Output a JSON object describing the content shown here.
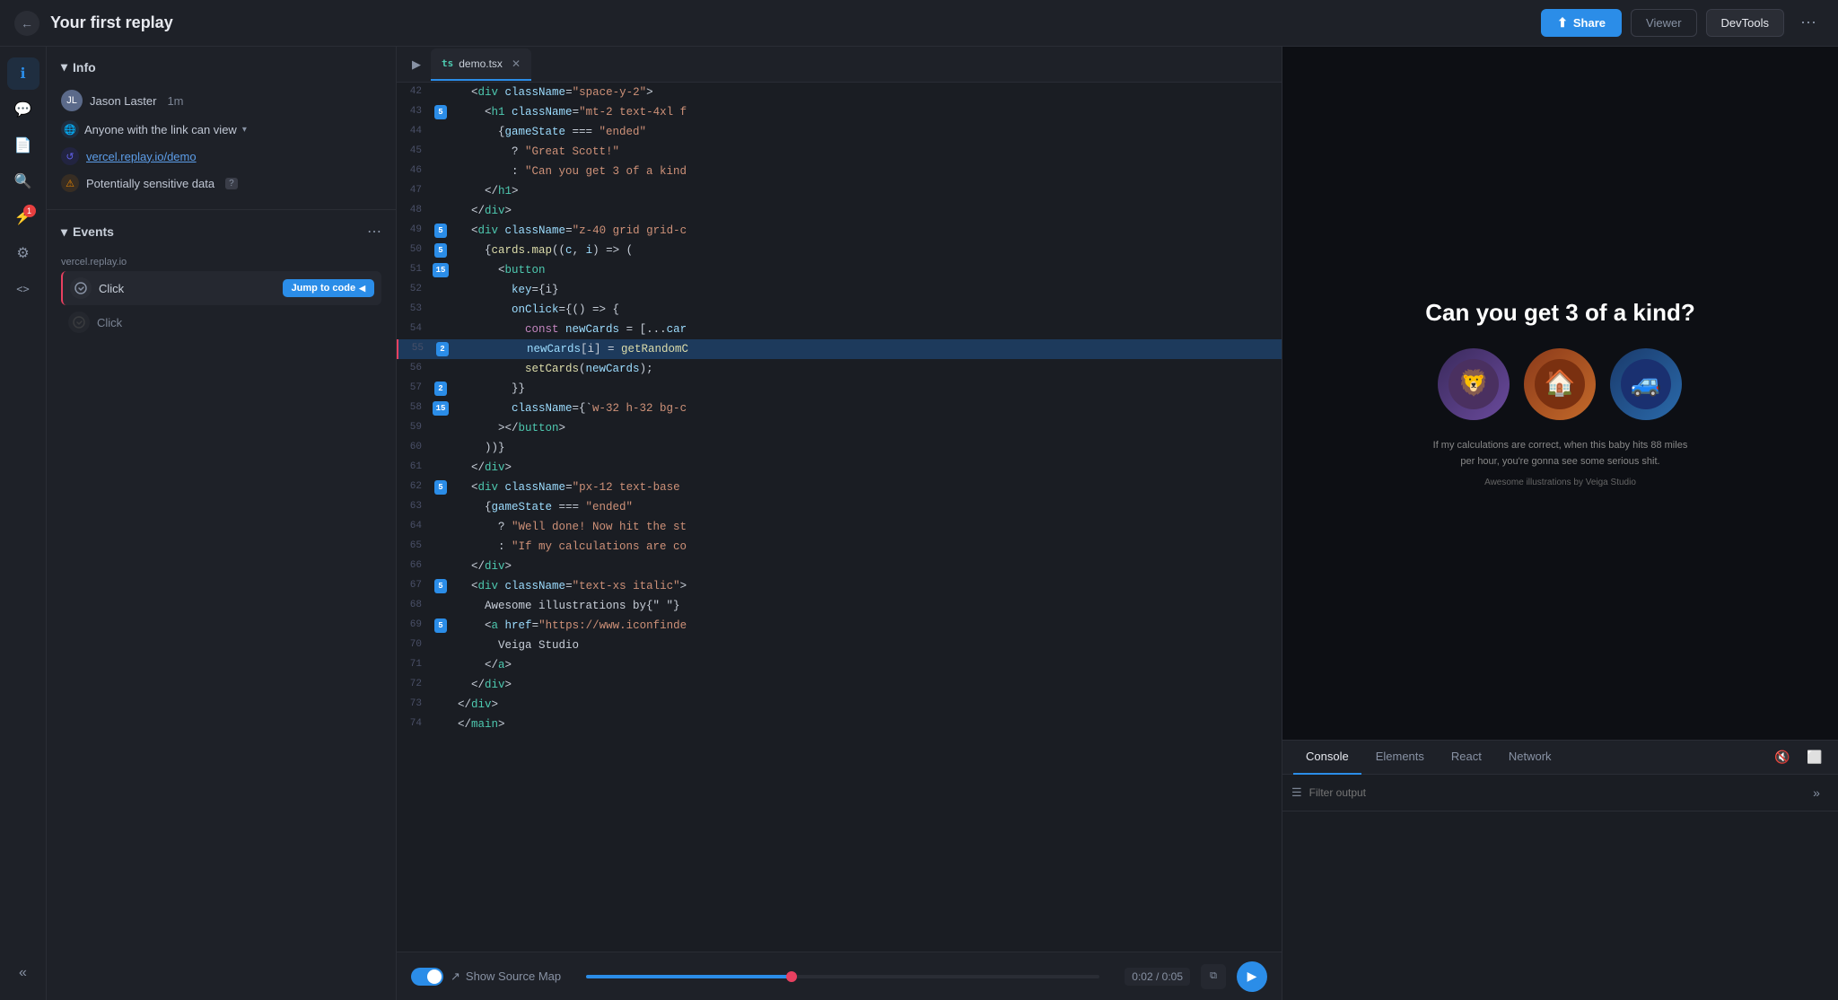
{
  "topbar": {
    "back_icon": "←",
    "title": "Your first replay",
    "share_label": "Share",
    "viewer_label": "Viewer",
    "devtools_label": "DevTools",
    "more_icon": "⋯"
  },
  "sidebar": {
    "icons": [
      {
        "name": "info-icon",
        "symbol": "ℹ",
        "active": true
      },
      {
        "name": "comment-icon",
        "symbol": "💬",
        "active": false
      },
      {
        "name": "document-icon",
        "symbol": "📄",
        "active": false
      },
      {
        "name": "search-icon",
        "symbol": "🔍",
        "active": false
      },
      {
        "name": "activity-icon",
        "symbol": "⚡",
        "active": false,
        "badge": "1"
      },
      {
        "name": "settings-icon",
        "symbol": "⚙",
        "active": false
      },
      {
        "name": "code-icon",
        "symbol": "<>",
        "active": false
      },
      {
        "name": "collapse-icon",
        "symbol": "«",
        "active": false
      }
    ]
  },
  "info": {
    "section_label": "Info",
    "user_name": "Jason Laster",
    "user_timestamp": "1m",
    "link_text": "Anyone with the link can view",
    "url": "vercel.replay.io/demo",
    "sensitive_label": "Potentially sensitive data",
    "help_label": "?"
  },
  "events": {
    "section_label": "Events",
    "group_label": "vercel.replay.io",
    "items": [
      {
        "label": "Click",
        "active": true,
        "show_jump": true,
        "jump_label": "Jump to code"
      },
      {
        "label": "Click",
        "active": false,
        "show_jump": false
      }
    ]
  },
  "editor": {
    "tab_name": "demo.tsx",
    "tab_icon": "ts",
    "lines": [
      {
        "num": 42,
        "badge": null,
        "content": "  <div className=\"space-y-2\">"
      },
      {
        "num": 43,
        "badge": "5",
        "badge_color": "blue",
        "content": "    <h1 className=\"mt-2 text-4xl f"
      },
      {
        "num": 44,
        "badge": null,
        "content": "      {gameState === \"ended\""
      },
      {
        "num": 45,
        "badge": null,
        "content": "        ? \"Great Scott!\""
      },
      {
        "num": 46,
        "badge": null,
        "content": "        : \"Can you get 3 of a kind"
      },
      {
        "num": 47,
        "badge": null,
        "content": "    </h1>"
      },
      {
        "num": 48,
        "badge": null,
        "content": "  </div>"
      },
      {
        "num": 49,
        "badge": "5",
        "badge_color": "blue",
        "content": "  <div className=\"z-40 grid grid-c"
      },
      {
        "num": 50,
        "badge": "5",
        "badge_color": "blue",
        "content": "    {cards.map((c, i) => ("
      },
      {
        "num": 51,
        "badge": "15",
        "badge_color": "blue",
        "content": "      <button"
      },
      {
        "num": 52,
        "badge": null,
        "content": "        key={i}"
      },
      {
        "num": 53,
        "badge": null,
        "content": "        onClick={() => {"
      },
      {
        "num": 54,
        "badge": null,
        "content": "          const newCards = [...car"
      },
      {
        "num": 55,
        "badge": "2",
        "badge_color": "blue",
        "active": true,
        "content": "          newCards[i] = getRandomC"
      },
      {
        "num": 56,
        "badge": null,
        "content": "          setCards(newCards);"
      },
      {
        "num": 57,
        "badge": "2",
        "badge_color": "blue",
        "content": "        }}"
      },
      {
        "num": 58,
        "badge": "15",
        "badge_color": "blue",
        "content": "        className={`w-32 h-32 bg-c"
      },
      {
        "num": 59,
        "badge": null,
        "content": "      ></button>"
      },
      {
        "num": 60,
        "badge": null,
        "content": "    ))}"
      },
      {
        "num": 61,
        "badge": null,
        "content": "  </div>"
      },
      {
        "num": 62,
        "badge": "5",
        "badge_color": "blue",
        "content": "  <div className=\"px-12 text-base"
      },
      {
        "num": 63,
        "badge": null,
        "content": "    {gameState === \"ended\""
      },
      {
        "num": 64,
        "badge": null,
        "content": "      ? \"Well done! Now hit the st"
      },
      {
        "num": 65,
        "badge": null,
        "content": "      : \"If my calculations are co"
      },
      {
        "num": 66,
        "badge": null,
        "content": "  </div>"
      },
      {
        "num": 67,
        "badge": "5",
        "badge_color": "blue",
        "content": "  <div className=\"text-xs italic\">"
      },
      {
        "num": 68,
        "badge": null,
        "content": "    Awesome illustrations by{\" \"}"
      },
      {
        "num": 69,
        "badge": "5",
        "badge_color": "blue",
        "content": "    <a href=\"https://www.iconfinde"
      },
      {
        "num": 70,
        "badge": null,
        "content": "      Veiga Studio"
      },
      {
        "num": 71,
        "badge": null,
        "content": "    </a>"
      },
      {
        "num": 72,
        "badge": null,
        "content": "  </div>"
      },
      {
        "num": 73,
        "badge": null,
        "content": "</div>"
      },
      {
        "num": 74,
        "badge": null,
        "content": "</main>"
      }
    ],
    "source_map_label": "Show Source Map"
  },
  "preview": {
    "title": "Can you get 3 of a kind?",
    "card_emojis": [
      "🦁",
      "🏠",
      "🚙"
    ],
    "caption": "If my calculations are correct, when this baby hits 88 miles per hour, you're gonna see some serious shit.",
    "subcaption": "Awesome illustrations by Veiga Studio"
  },
  "devtools": {
    "tabs": [
      "Console",
      "Elements",
      "React",
      "Network"
    ],
    "active_tab": "Console",
    "filter_placeholder": "Filter output"
  },
  "timeline": {
    "current_time": "0:02",
    "total_time": "0:05",
    "progress_percent": 40
  }
}
